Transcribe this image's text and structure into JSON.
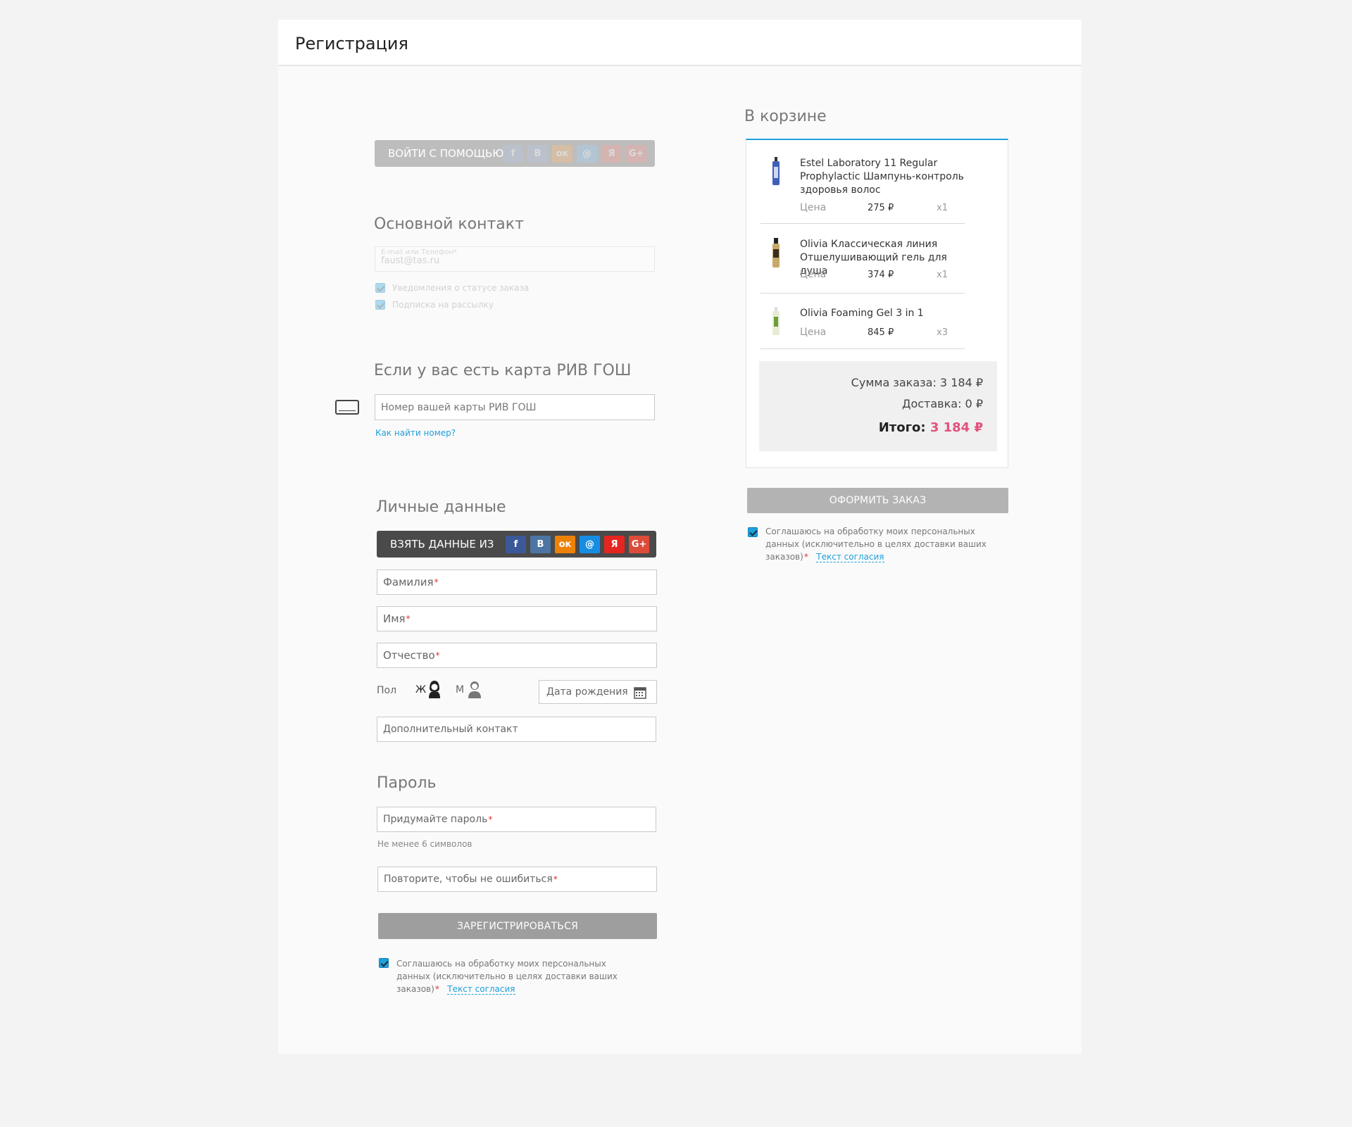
{
  "page": {
    "title": "Регистрация"
  },
  "login_social": {
    "label": "ВОЙТИ С ПОМОЩЬЮ",
    "icons": [
      {
        "name": "facebook-icon",
        "glyph": "f"
      },
      {
        "name": "vk-icon",
        "glyph": "В"
      },
      {
        "name": "odnoklassniki-icon",
        "glyph": "ок"
      },
      {
        "name": "mailru-icon",
        "glyph": "@"
      },
      {
        "name": "yandex-icon",
        "glyph": "Я"
      },
      {
        "name": "google-plus-icon",
        "glyph": "G+"
      }
    ]
  },
  "contact": {
    "heading": "Основной контакт",
    "field_label": "E-mail или Телефон*",
    "field_value": "faust@tas.ru",
    "notify_label": "Уведомления о статусе заказа",
    "subscribe_label": "Подписка на рассылку"
  },
  "card": {
    "heading": "Если у вас есть карта РИВ ГОШ",
    "placeholder": "Номер вашей карты РИВ ГОШ",
    "help_link": "Как найти номер?"
  },
  "personal": {
    "heading": "Личные данные",
    "take_label": "ВЗЯТЬ ДАННЫЕ ИЗ",
    "lastname": "Фамилия",
    "firstname": "Имя",
    "middlename": "Отчество",
    "gender_label": "Пол",
    "gender_female": "Ж",
    "gender_male": "М",
    "birthdate": "Дата рождения",
    "extra_contact": "Дополнительный контакт"
  },
  "password": {
    "heading": "Пароль",
    "create": "Придумайте пароль",
    "hint": "Не менее 6 символов",
    "repeat": "Повторите, чтобы не ошибиться"
  },
  "register_button": "ЗАРЕГИСТРИРОВАТЬСЯ",
  "consent": {
    "line1": "Соглашаюсь на обработку моих персональных",
    "line2": "данных (исключительно в целях доставки ваших",
    "line3": "заказов)",
    "req": "*",
    "link": "Текст согласия"
  },
  "cart": {
    "heading": "В корзине",
    "price_label": "Цена",
    "items": [
      {
        "name": "Estel Laboratory 11 Regular Prophylactic Шампунь-контроль здоровья волос",
        "price": "275 ₽",
        "qty": "x1"
      },
      {
        "name": "Olivia Классическая линия Отшелушивающий гель для душа",
        "price": "374 ₽",
        "qty": "x1"
      },
      {
        "name": "Olivia Foaming Gel 3 in 1",
        "price": "845 ₽",
        "qty": "x3"
      }
    ],
    "sum_label": "Сумма заказа:",
    "sum_value": "3 184 ₽",
    "delivery_label": "Доставка:",
    "delivery_value": "0 ₽",
    "total_label": "Итого:",
    "total_value": "3 184 ₽",
    "checkout_button": "ОФОРМИТЬ ЗАКАЗ"
  },
  "colors": {
    "accent": "#1ea0da",
    "total": "#e2527c",
    "button": "#9e9e9e"
  }
}
